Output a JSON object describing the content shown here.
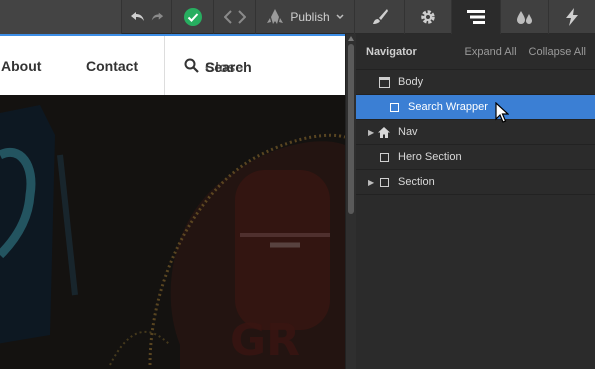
{
  "toolbar": {
    "publish_label": "Publish"
  },
  "canvas": {
    "nav_links": [
      "About",
      "Contact"
    ],
    "search_label": "Search",
    "search_overlap_label": "Close"
  },
  "navigator": {
    "title": "Navigator",
    "expand_all": "Expand All",
    "collapse_all": "Collapse All",
    "items": [
      {
        "label": "Body",
        "icon": "page-icon",
        "selected": false,
        "has_children": false
      },
      {
        "label": "Search Wrapper",
        "icon": "box-icon",
        "selected": true,
        "has_children": false
      },
      {
        "label": "Nav",
        "icon": "home-icon",
        "selected": false,
        "has_children": true
      },
      {
        "label": "Hero Section",
        "icon": "box-icon",
        "selected": false,
        "has_children": false
      },
      {
        "label": "Section",
        "icon": "box-icon",
        "selected": false,
        "has_children": true
      }
    ]
  },
  "colors": {
    "accent": "#3b7fd4",
    "status_ok": "#27ae60"
  }
}
